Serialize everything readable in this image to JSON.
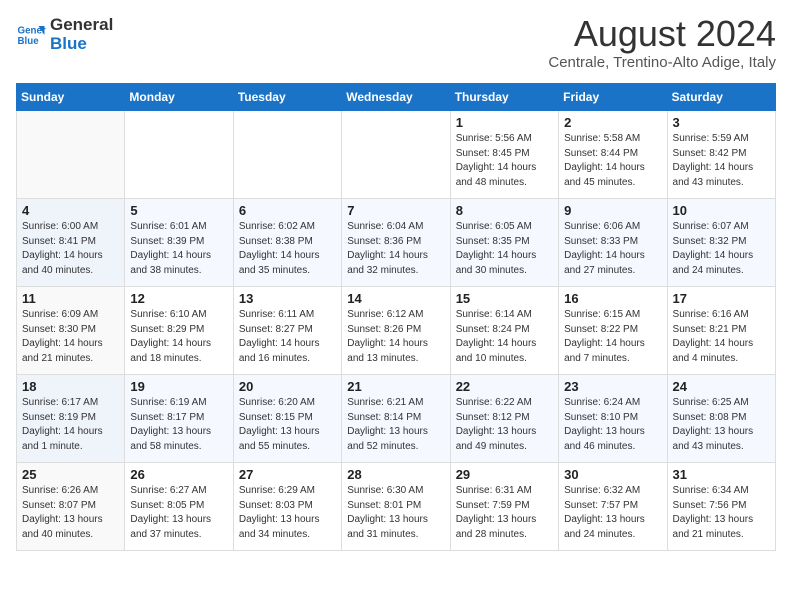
{
  "header": {
    "logo_line1": "General",
    "logo_line2": "Blue",
    "month_title": "August 2024",
    "location": "Centrale, Trentino-Alto Adige, Italy"
  },
  "weekdays": [
    "Sunday",
    "Monday",
    "Tuesday",
    "Wednesday",
    "Thursday",
    "Friday",
    "Saturday"
  ],
  "rows": [
    [
      {
        "day": "",
        "info": ""
      },
      {
        "day": "",
        "info": ""
      },
      {
        "day": "",
        "info": ""
      },
      {
        "day": "",
        "info": ""
      },
      {
        "day": "1",
        "info": "Sunrise: 5:56 AM\nSunset: 8:45 PM\nDaylight: 14 hours\nand 48 minutes."
      },
      {
        "day": "2",
        "info": "Sunrise: 5:58 AM\nSunset: 8:44 PM\nDaylight: 14 hours\nand 45 minutes."
      },
      {
        "day": "3",
        "info": "Sunrise: 5:59 AM\nSunset: 8:42 PM\nDaylight: 14 hours\nand 43 minutes."
      }
    ],
    [
      {
        "day": "4",
        "info": "Sunrise: 6:00 AM\nSunset: 8:41 PM\nDaylight: 14 hours\nand 40 minutes."
      },
      {
        "day": "5",
        "info": "Sunrise: 6:01 AM\nSunset: 8:39 PM\nDaylight: 14 hours\nand 38 minutes."
      },
      {
        "day": "6",
        "info": "Sunrise: 6:02 AM\nSunset: 8:38 PM\nDaylight: 14 hours\nand 35 minutes."
      },
      {
        "day": "7",
        "info": "Sunrise: 6:04 AM\nSunset: 8:36 PM\nDaylight: 14 hours\nand 32 minutes."
      },
      {
        "day": "8",
        "info": "Sunrise: 6:05 AM\nSunset: 8:35 PM\nDaylight: 14 hours\nand 30 minutes."
      },
      {
        "day": "9",
        "info": "Sunrise: 6:06 AM\nSunset: 8:33 PM\nDaylight: 14 hours\nand 27 minutes."
      },
      {
        "day": "10",
        "info": "Sunrise: 6:07 AM\nSunset: 8:32 PM\nDaylight: 14 hours\nand 24 minutes."
      }
    ],
    [
      {
        "day": "11",
        "info": "Sunrise: 6:09 AM\nSunset: 8:30 PM\nDaylight: 14 hours\nand 21 minutes."
      },
      {
        "day": "12",
        "info": "Sunrise: 6:10 AM\nSunset: 8:29 PM\nDaylight: 14 hours\nand 18 minutes."
      },
      {
        "day": "13",
        "info": "Sunrise: 6:11 AM\nSunset: 8:27 PM\nDaylight: 14 hours\nand 16 minutes."
      },
      {
        "day": "14",
        "info": "Sunrise: 6:12 AM\nSunset: 8:26 PM\nDaylight: 14 hours\nand 13 minutes."
      },
      {
        "day": "15",
        "info": "Sunrise: 6:14 AM\nSunset: 8:24 PM\nDaylight: 14 hours\nand 10 minutes."
      },
      {
        "day": "16",
        "info": "Sunrise: 6:15 AM\nSunset: 8:22 PM\nDaylight: 14 hours\nand 7 minutes."
      },
      {
        "day": "17",
        "info": "Sunrise: 6:16 AM\nSunset: 8:21 PM\nDaylight: 14 hours\nand 4 minutes."
      }
    ],
    [
      {
        "day": "18",
        "info": "Sunrise: 6:17 AM\nSunset: 8:19 PM\nDaylight: 14 hours\nand 1 minute."
      },
      {
        "day": "19",
        "info": "Sunrise: 6:19 AM\nSunset: 8:17 PM\nDaylight: 13 hours\nand 58 minutes."
      },
      {
        "day": "20",
        "info": "Sunrise: 6:20 AM\nSunset: 8:15 PM\nDaylight: 13 hours\nand 55 minutes."
      },
      {
        "day": "21",
        "info": "Sunrise: 6:21 AM\nSunset: 8:14 PM\nDaylight: 13 hours\nand 52 minutes."
      },
      {
        "day": "22",
        "info": "Sunrise: 6:22 AM\nSunset: 8:12 PM\nDaylight: 13 hours\nand 49 minutes."
      },
      {
        "day": "23",
        "info": "Sunrise: 6:24 AM\nSunset: 8:10 PM\nDaylight: 13 hours\nand 46 minutes."
      },
      {
        "day": "24",
        "info": "Sunrise: 6:25 AM\nSunset: 8:08 PM\nDaylight: 13 hours\nand 43 minutes."
      }
    ],
    [
      {
        "day": "25",
        "info": "Sunrise: 6:26 AM\nSunset: 8:07 PM\nDaylight: 13 hours\nand 40 minutes."
      },
      {
        "day": "26",
        "info": "Sunrise: 6:27 AM\nSunset: 8:05 PM\nDaylight: 13 hours\nand 37 minutes."
      },
      {
        "day": "27",
        "info": "Sunrise: 6:29 AM\nSunset: 8:03 PM\nDaylight: 13 hours\nand 34 minutes."
      },
      {
        "day": "28",
        "info": "Sunrise: 6:30 AM\nSunset: 8:01 PM\nDaylight: 13 hours\nand 31 minutes."
      },
      {
        "day": "29",
        "info": "Sunrise: 6:31 AM\nSunset: 7:59 PM\nDaylight: 13 hours\nand 28 minutes."
      },
      {
        "day": "30",
        "info": "Sunrise: 6:32 AM\nSunset: 7:57 PM\nDaylight: 13 hours\nand 24 minutes."
      },
      {
        "day": "31",
        "info": "Sunrise: 6:34 AM\nSunset: 7:56 PM\nDaylight: 13 hours\nand 21 minutes."
      }
    ]
  ]
}
